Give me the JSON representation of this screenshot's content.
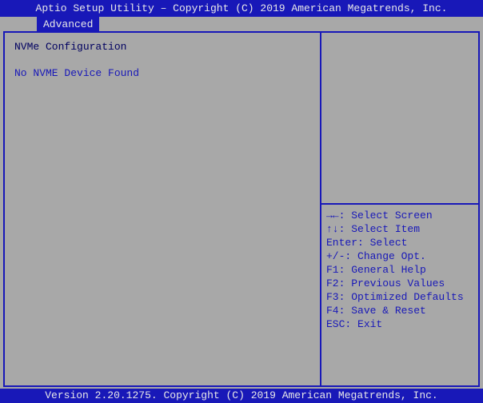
{
  "header": {
    "title": "Aptio Setup Utility – Copyright (C) 2019 American Megatrends, Inc."
  },
  "tabs": {
    "active": "Advanced"
  },
  "main": {
    "section_title": "NVMe Configuration",
    "status_text": "No NVME Device Found"
  },
  "help": {
    "lines": [
      {
        "key": "→←",
        "desc": "Select Screen"
      },
      {
        "key": "↑↓",
        "desc": "Select Item"
      },
      {
        "key": "Enter",
        "desc": "Select"
      },
      {
        "key": "+/-",
        "desc": "Change Opt."
      },
      {
        "key": "F1",
        "desc": "General Help"
      },
      {
        "key": "F2",
        "desc": "Previous Values"
      },
      {
        "key": "F3",
        "desc": "Optimized Defaults"
      },
      {
        "key": "F4",
        "desc": "Save & Reset"
      },
      {
        "key": "ESC",
        "desc": "Exit"
      }
    ]
  },
  "footer": {
    "text": "Version 2.20.1275. Copyright (C) 2019 American Megatrends, Inc."
  }
}
